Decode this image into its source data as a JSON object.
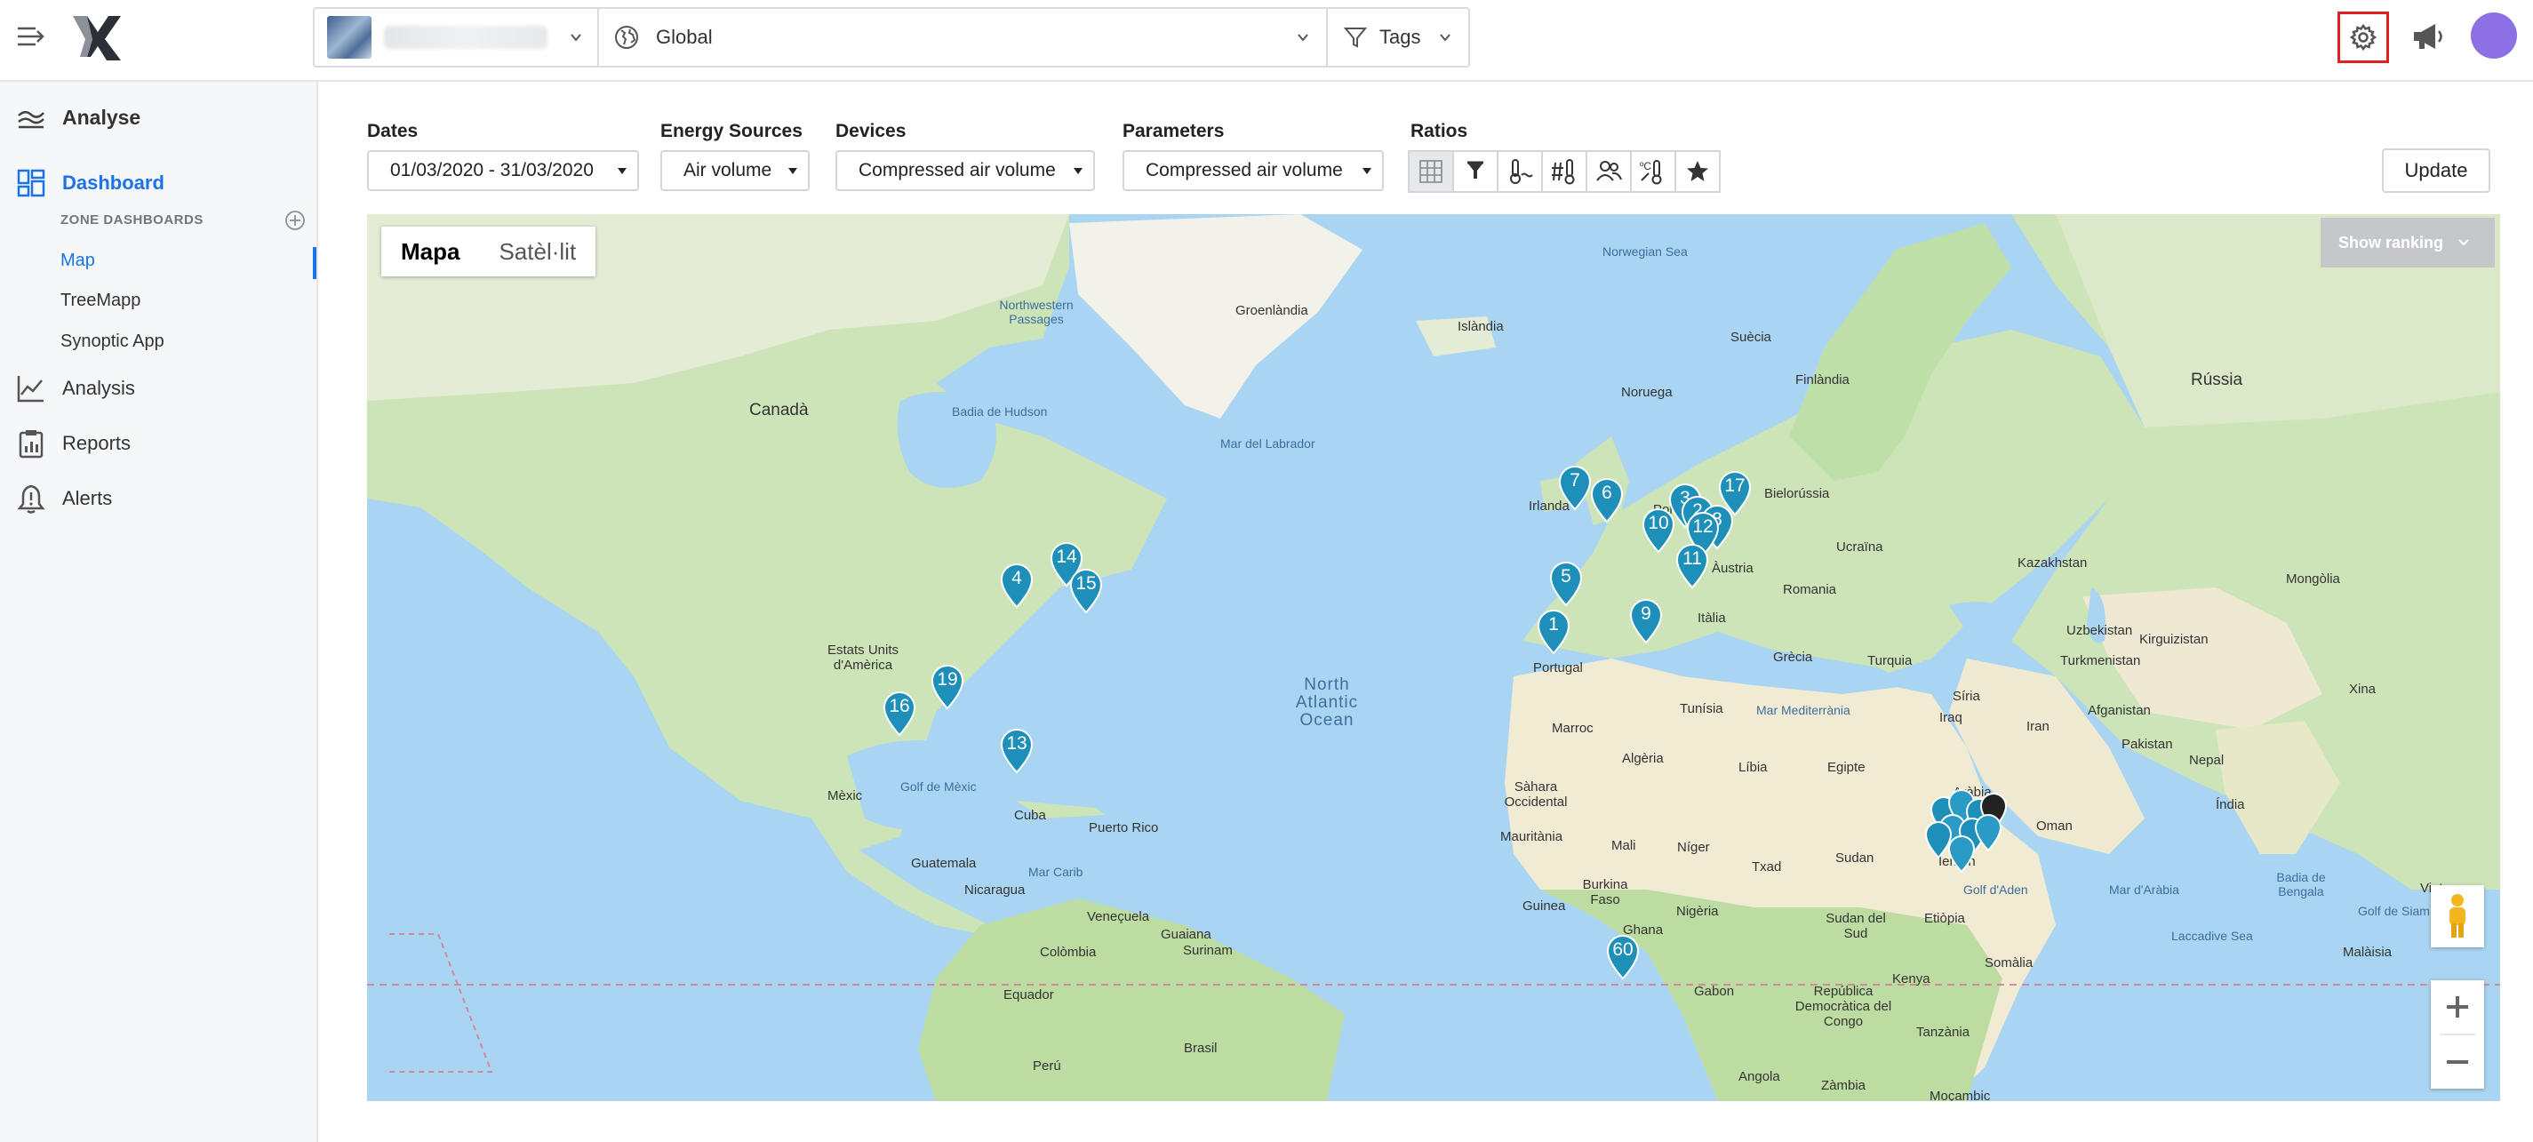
{
  "topbar": {
    "global_label": "Global",
    "tags_label": "Tags"
  },
  "sidebar": {
    "analyse_label": "Analyse",
    "dashboard_label": "Dashboard",
    "zone_dashboards_label": "ZONE DASHBOARDS",
    "sub_items": [
      {
        "label": "Map",
        "active": true
      },
      {
        "label": "TreeMapp",
        "active": false
      },
      {
        "label": "Synoptic App",
        "active": false
      }
    ],
    "items": [
      {
        "label": "Analysis"
      },
      {
        "label": "Reports"
      },
      {
        "label": "Alerts"
      }
    ]
  },
  "filters": {
    "dates": {
      "label": "Dates",
      "value": "01/03/2020 - 31/03/2020"
    },
    "energy_sources": {
      "label": "Energy Sources",
      "value": "Air volume"
    },
    "devices": {
      "label": "Devices",
      "value": "Compressed air volume"
    },
    "parameters": {
      "label": "Parameters",
      "value": "Compressed air volume"
    },
    "ratios": {
      "label": "Ratios"
    },
    "update_label": "Update"
  },
  "map": {
    "type_map_label": "Mapa",
    "type_satellite_label": "Satèl·lit",
    "ranking_label": "Show ranking",
    "ocean_label": "North Atlantic Ocean",
    "place_labels": [
      "Norwegian Sea",
      "Groenlàndia",
      "Islàndia",
      "Suècia",
      "Finlàndia",
      "Noruega",
      "Rússia",
      "Canadà",
      "Badia de Hudson",
      "Mar del Labrador",
      "Irlanda",
      "Polònia",
      "Bielorússia",
      "Ucraïna",
      "Kazakhstan",
      "Mongòlia",
      "Romania",
      "Itàlia",
      "Uzbekistan",
      "Turkmenistan",
      "Grècia",
      "Turquia",
      "Estats Units d'Amèrica",
      "Portugal",
      "Tunísia",
      "Mar Mediterrània",
      "Síria",
      "Iraq",
      "Afganistan",
      "Iran",
      "Pakistan",
      "Xina",
      "Marroc",
      "Algèria",
      "Líbia",
      "Egipte",
      "Aràbia Saudita",
      "Índia",
      "Golf de Mèxic",
      "Mèxic",
      "Cuba",
      "Sàhara Occidental",
      "Mauritània",
      "Mali",
      "Níger",
      "Txad",
      "Sudan",
      "Iemen",
      "Oman",
      "Golf d'Aden",
      "Mar d'Aràbia",
      "Badia de Bengala",
      "Vietnam",
      "Mar Carib",
      "Guatemala",
      "Nicaragua",
      "Veneçuela",
      "Colòmbia",
      "Guaiana",
      "Surinam",
      "Equador",
      "Perú",
      "Brasil",
      "Burkina Faso",
      "Guinea",
      "Nigèria",
      "Sudan del Sud",
      "Etiòpia",
      "Somàlia",
      "Kenya",
      "Gabon",
      "República Democràtica del Congo",
      "Tanzània",
      "Angola",
      "Zàmbia",
      "Moçambic",
      "Malàisia",
      "Laccadive Sea",
      "Puerto Rico",
      "Ghana",
      "Northwestern Passages",
      "Golf de Siam",
      "Nepal",
      "Kirguizistan",
      "Àustria"
    ],
    "markers": [
      "7",
      "6",
      "17",
      "10",
      "2",
      "3",
      "12",
      "8",
      "11",
      "14",
      "4",
      "15",
      "19",
      "16",
      "13",
      "60",
      "1",
      "5",
      "9"
    ]
  }
}
